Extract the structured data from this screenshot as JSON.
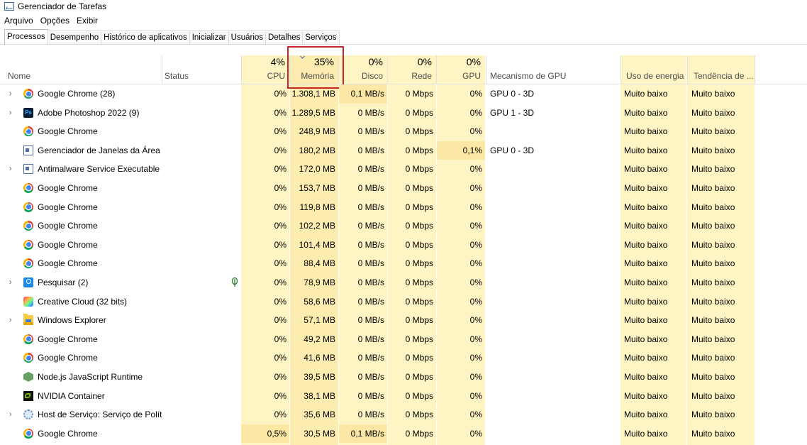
{
  "window": {
    "title": "Gerenciador de Tarefas"
  },
  "menu": [
    "Arquivo",
    "Opções",
    "Exibir"
  ],
  "tabs": [
    "Processos",
    "Desempenho",
    "Histórico de aplicativos",
    "Inicializar",
    "Usuários",
    "Detalhes",
    "Serviços"
  ],
  "active_tab": "Processos",
  "columns": {
    "name": "Nome",
    "status": "Status",
    "cpu": {
      "label": "CPU",
      "total": "4%"
    },
    "memory": {
      "label": "Memória",
      "total": "35%"
    },
    "disk": {
      "label": "Disco",
      "total": "0%"
    },
    "network": {
      "label": "Rede",
      "total": "0%"
    },
    "gpu": {
      "label": "GPU",
      "total": "0%"
    },
    "gpu_engine": "Mecanismo de GPU",
    "power": "Uso de energia",
    "power_trend": "Tendência de ..."
  },
  "sorted_column": "memory",
  "highlight_color": "#c62828",
  "processes": [
    {
      "name": "Google Chrome (28)",
      "icon": "chrome-icon",
      "expandable": true,
      "status_icon": "",
      "cpu": "0%",
      "memory": "1.308,1 MB",
      "disk": "0,1 MB/s",
      "network": "0 Mbps",
      "gpu": "0%",
      "gpu_engine": "GPU 0 - 3D",
      "power": "Muito baixo",
      "trend": "Muito baixo"
    },
    {
      "name": "Adobe Photoshop 2022 (9)",
      "icon": "photoshop-icon",
      "expandable": true,
      "status_icon": "",
      "cpu": "0%",
      "memory": "1.289,5 MB",
      "disk": "0 MB/s",
      "network": "0 Mbps",
      "gpu": "0%",
      "gpu_engine": "GPU 1 - 3D",
      "power": "Muito baixo",
      "trend": "Muito baixo"
    },
    {
      "name": "Google Chrome",
      "icon": "chrome-icon",
      "expandable": false,
      "status_icon": "",
      "cpu": "0%",
      "memory": "248,9 MB",
      "disk": "0 MB/s",
      "network": "0 Mbps",
      "gpu": "0%",
      "gpu_engine": "",
      "power": "Muito baixo",
      "trend": "Muito baixo"
    },
    {
      "name": "Gerenciador de Janelas da Área ...",
      "icon": "window-icon",
      "expandable": false,
      "status_icon": "",
      "cpu": "0%",
      "memory": "180,2 MB",
      "disk": "0 MB/s",
      "network": "0 Mbps",
      "gpu": "0,1%",
      "gpu_engine": "GPU 0 - 3D",
      "power": "Muito baixo",
      "trend": "Muito baixo"
    },
    {
      "name": "Antimalware Service Executable",
      "icon": "window-icon",
      "expandable": true,
      "status_icon": "",
      "cpu": "0%",
      "memory": "172,0 MB",
      "disk": "0 MB/s",
      "network": "0 Mbps",
      "gpu": "0%",
      "gpu_engine": "",
      "power": "Muito baixo",
      "trend": "Muito baixo"
    },
    {
      "name": "Google Chrome",
      "icon": "chrome-icon",
      "expandable": false,
      "status_icon": "",
      "cpu": "0%",
      "memory": "153,7 MB",
      "disk": "0 MB/s",
      "network": "0 Mbps",
      "gpu": "0%",
      "gpu_engine": "",
      "power": "Muito baixo",
      "trend": "Muito baixo"
    },
    {
      "name": "Google Chrome",
      "icon": "chrome-icon",
      "expandable": false,
      "status_icon": "",
      "cpu": "0%",
      "memory": "119,8 MB",
      "disk": "0 MB/s",
      "network": "0 Mbps",
      "gpu": "0%",
      "gpu_engine": "",
      "power": "Muito baixo",
      "trend": "Muito baixo"
    },
    {
      "name": "Google Chrome",
      "icon": "chrome-icon",
      "expandable": false,
      "status_icon": "",
      "cpu": "0%",
      "memory": "102,2 MB",
      "disk": "0 MB/s",
      "network": "0 Mbps",
      "gpu": "0%",
      "gpu_engine": "",
      "power": "Muito baixo",
      "trend": "Muito baixo"
    },
    {
      "name": "Google Chrome",
      "icon": "chrome-icon",
      "expandable": false,
      "status_icon": "",
      "cpu": "0%",
      "memory": "101,4 MB",
      "disk": "0 MB/s",
      "network": "0 Mbps",
      "gpu": "0%",
      "gpu_engine": "",
      "power": "Muito baixo",
      "trend": "Muito baixo"
    },
    {
      "name": "Google Chrome",
      "icon": "chrome-icon",
      "expandable": false,
      "status_icon": "",
      "cpu": "0%",
      "memory": "88,4 MB",
      "disk": "0 MB/s",
      "network": "0 Mbps",
      "gpu": "0%",
      "gpu_engine": "",
      "power": "Muito baixo",
      "trend": "Muito baixo"
    },
    {
      "name": "Pesquisar (2)",
      "icon": "search-app-icon",
      "expandable": true,
      "status_icon": "suspended-leaf-icon",
      "cpu": "0%",
      "memory": "78,9 MB",
      "disk": "0 MB/s",
      "network": "0 Mbps",
      "gpu": "0%",
      "gpu_engine": "",
      "power": "Muito baixo",
      "trend": "Muito baixo"
    },
    {
      "name": "Creative Cloud (32 bits)",
      "icon": "creative-cloud-icon",
      "expandable": false,
      "status_icon": "",
      "cpu": "0%",
      "memory": "58,6 MB",
      "disk": "0 MB/s",
      "network": "0 Mbps",
      "gpu": "0%",
      "gpu_engine": "",
      "power": "Muito baixo",
      "trend": "Muito baixo"
    },
    {
      "name": "Windows Explorer",
      "icon": "folder-icon",
      "expandable": true,
      "status_icon": "",
      "cpu": "0%",
      "memory": "57,1 MB",
      "disk": "0 MB/s",
      "network": "0 Mbps",
      "gpu": "0%",
      "gpu_engine": "",
      "power": "Muito baixo",
      "trend": "Muito baixo"
    },
    {
      "name": "Google Chrome",
      "icon": "chrome-icon",
      "expandable": false,
      "status_icon": "",
      "cpu": "0%",
      "memory": "49,2 MB",
      "disk": "0 MB/s",
      "network": "0 Mbps",
      "gpu": "0%",
      "gpu_engine": "",
      "power": "Muito baixo",
      "trend": "Muito baixo"
    },
    {
      "name": "Google Chrome",
      "icon": "chrome-icon",
      "expandable": false,
      "status_icon": "",
      "cpu": "0%",
      "memory": "41,6 MB",
      "disk": "0 MB/s",
      "network": "0 Mbps",
      "gpu": "0%",
      "gpu_engine": "",
      "power": "Muito baixo",
      "trend": "Muito baixo"
    },
    {
      "name": "Node.js JavaScript Runtime",
      "icon": "nodejs-icon",
      "expandable": false,
      "status_icon": "",
      "cpu": "0%",
      "memory": "39,5 MB",
      "disk": "0 MB/s",
      "network": "0 Mbps",
      "gpu": "0%",
      "gpu_engine": "",
      "power": "Muito baixo",
      "trend": "Muito baixo"
    },
    {
      "name": "NVIDIA Container",
      "icon": "nvidia-icon",
      "expandable": false,
      "status_icon": "",
      "cpu": "0%",
      "memory": "38,1 MB",
      "disk": "0 MB/s",
      "network": "0 Mbps",
      "gpu": "0%",
      "gpu_engine": "",
      "power": "Muito baixo",
      "trend": "Muito baixo"
    },
    {
      "name": "Host de Serviço: Serviço de Polít...",
      "icon": "service-gear-icon",
      "expandable": true,
      "status_icon": "",
      "cpu": "0%",
      "memory": "35,6 MB",
      "disk": "0 MB/s",
      "network": "0 Mbps",
      "gpu": "0%",
      "gpu_engine": "",
      "power": "Muito baixo",
      "trend": "Muito baixo"
    },
    {
      "name": "Google Chrome",
      "icon": "chrome-icon",
      "expandable": false,
      "status_icon": "",
      "cpu": "0,5%",
      "memory": "30,5 MB",
      "disk": "0,1 MB/s",
      "network": "0 Mbps",
      "gpu": "0%",
      "gpu_engine": "",
      "power": "Muito baixo",
      "trend": "Muito baixo"
    }
  ]
}
